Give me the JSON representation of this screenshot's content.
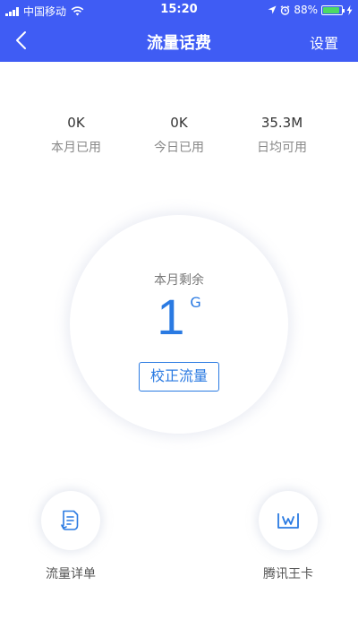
{
  "status_bar": {
    "carrier": "中国移动",
    "time": "15:20",
    "battery": "88%",
    "battery_level": 0.88,
    "icons": [
      "signal-icon",
      "wifi-icon",
      "location-icon",
      "alarm-icon",
      "battery-icon",
      "charging-icon"
    ]
  },
  "nav": {
    "back_icon": "chevron-left-icon",
    "title": "流量话费",
    "settings_label": "设置"
  },
  "stats": [
    {
      "value": "0K",
      "label": "本月已用"
    },
    {
      "value": "0K",
      "label": "今日已用"
    },
    {
      "value": "35.3M",
      "label": "日均可用"
    }
  ],
  "remaining": {
    "label": "本月剩余",
    "value": "1",
    "unit": "G",
    "calibrate_label": "校正流量"
  },
  "shortcuts": [
    {
      "label": "流量详单",
      "icon": "bill-list-icon"
    },
    {
      "label": "腾讯王卡",
      "icon": "tencent-king-card-icon"
    }
  ],
  "colors": {
    "header_bg": "#3f5cf4",
    "accent": "#2a7ae2",
    "battery": "#4cd964"
  }
}
